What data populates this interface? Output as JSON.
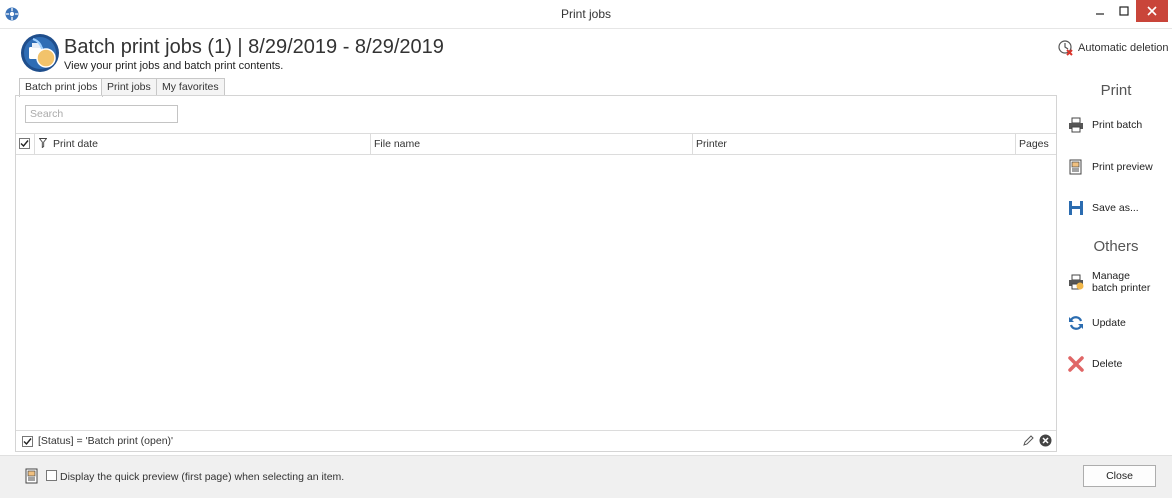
{
  "window": {
    "title": "Print jobs"
  },
  "header": {
    "title": "Batch print jobs (1) | 8/29/2019 - 8/29/2019",
    "subtitle": "View your print jobs and batch print contents.",
    "auto_deletion": "Automatic deletion"
  },
  "tabs": [
    {
      "label": "Batch print jobs",
      "active": true
    },
    {
      "label": "Print jobs",
      "active": false
    },
    {
      "label": "My favorites",
      "active": false
    }
  ],
  "search": {
    "placeholder": "Search",
    "value": ""
  },
  "grid": {
    "columns": [
      "Print date",
      "File name",
      "Printer",
      "Pages"
    ],
    "rows": []
  },
  "filter": {
    "text": "[Status] = 'Batch print (open)'",
    "enabled": true
  },
  "footer": {
    "quick_preview_label": "Display the quick preview (first page) when selecting an item.",
    "quick_preview_checked": false,
    "close_label": "Close"
  },
  "side_panel": {
    "print_title": "Print",
    "print_actions": [
      {
        "label": "Print batch",
        "icon": "printer-icon"
      },
      {
        "label": "Print preview",
        "icon": "print-preview-icon"
      },
      {
        "label": "Save as...",
        "icon": "save-icon"
      }
    ],
    "others_title": "Others",
    "other_actions": [
      {
        "label": "Manage batch printer",
        "line1": "Manage",
        "line2": "batch printer",
        "icon": "batch-printer-icon"
      },
      {
        "label": "Update",
        "icon": "refresh-icon"
      },
      {
        "label": "Delete",
        "icon": "delete-icon"
      }
    ]
  },
  "colors": {
    "accent": "#2b6cb0",
    "close_button": "#c9453a",
    "delete": "#e06666"
  }
}
